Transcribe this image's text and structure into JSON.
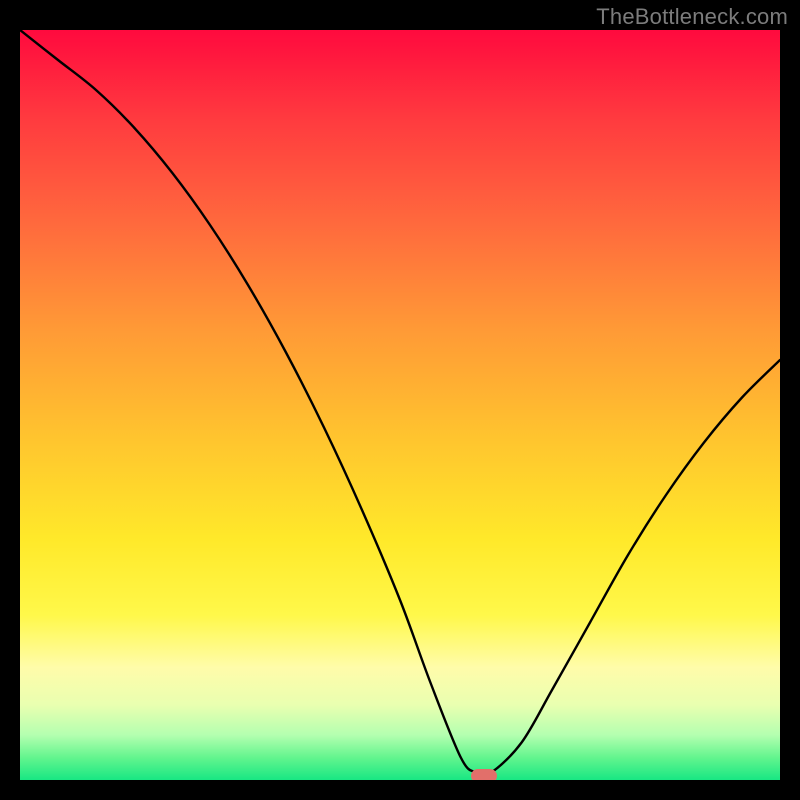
{
  "attribution": "TheBottleneck.com",
  "chart_data": {
    "type": "line",
    "title": "",
    "xlabel": "",
    "ylabel": "",
    "xlim": [
      0,
      100
    ],
    "ylim": [
      0,
      100
    ],
    "grid": false,
    "legend": false,
    "series": [
      {
        "name": "bottleneck-curve",
        "x": [
          0,
          5,
          10,
          15,
          20,
          25,
          30,
          35,
          40,
          45,
          50,
          54,
          58,
          60,
          62,
          66,
          70,
          75,
          80,
          85,
          90,
          95,
          100
        ],
        "y": [
          100,
          96,
          92,
          87,
          81,
          74,
          66,
          57,
          47,
          36,
          24,
          13,
          3,
          1,
          1,
          5,
          12,
          21,
          30,
          38,
          45,
          51,
          56
        ]
      }
    ],
    "annotations": [
      {
        "name": "optimal-marker",
        "x": 61,
        "y": 0.6
      }
    ],
    "background_gradient": {
      "stops": [
        {
          "pos": 0,
          "color": "#ff0a3e"
        },
        {
          "pos": 12,
          "color": "#ff3b3f"
        },
        {
          "pos": 26,
          "color": "#ff6a3d"
        },
        {
          "pos": 40,
          "color": "#ff9a36"
        },
        {
          "pos": 55,
          "color": "#ffc62e"
        },
        {
          "pos": 68,
          "color": "#ffe92a"
        },
        {
          "pos": 78,
          "color": "#fff84a"
        },
        {
          "pos": 85,
          "color": "#fffcaa"
        },
        {
          "pos": 90,
          "color": "#e9ffb0"
        },
        {
          "pos": 94,
          "color": "#b4ffb0"
        },
        {
          "pos": 97,
          "color": "#63f58e"
        },
        {
          "pos": 100,
          "color": "#18e783"
        }
      ]
    }
  }
}
